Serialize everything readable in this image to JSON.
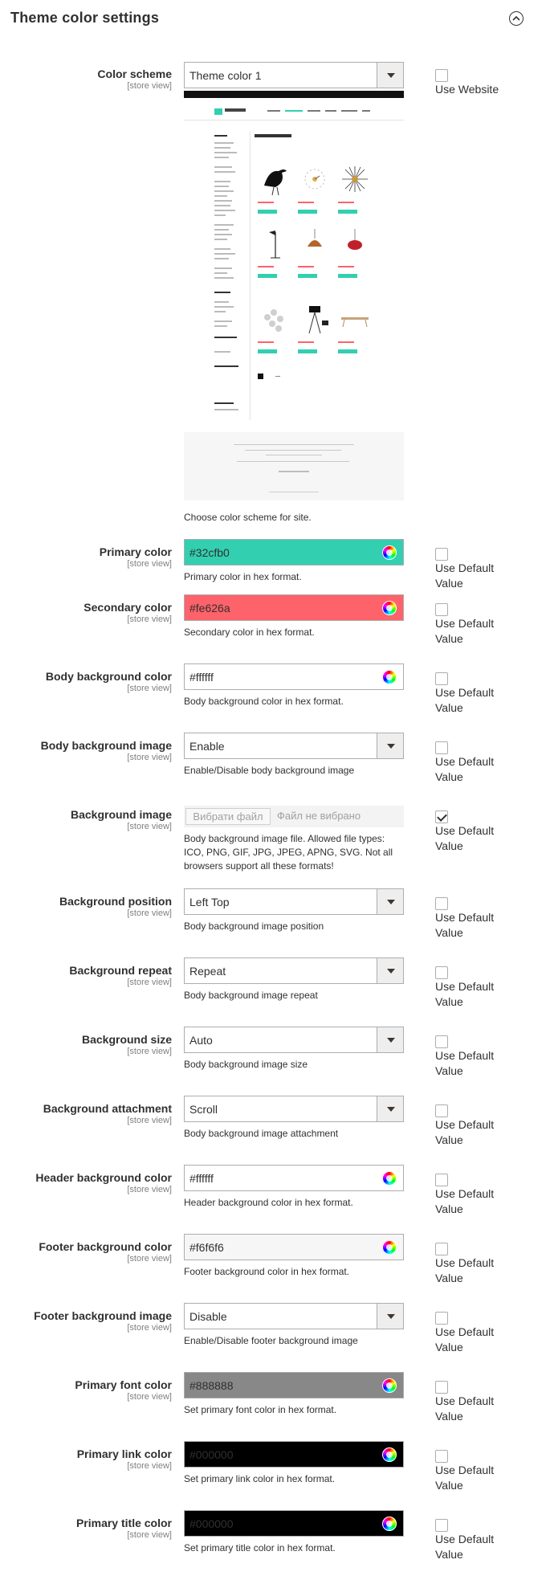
{
  "section": {
    "title": "Theme color settings",
    "collapse_icon": "chevron-up-icon"
  },
  "scope_text": "[store view]",
  "use_default_label": "Use Default Value",
  "color_scheme": {
    "label": "Color scheme",
    "value": "Theme color 1",
    "use_label": "Use Website",
    "note": "Choose color scheme for site.",
    "preview": {
      "page_heading": "Kitchen & Dining",
      "sidebar_extra": "Compare Products",
      "sidebar_wishlist": "My Wish List"
    }
  },
  "fields": [
    {
      "id": "primary",
      "label": "Primary color",
      "type": "color",
      "value": "#32cfb0",
      "bg": "#32cfb0",
      "fg": "#303030",
      "note": "Primary color in hex format.",
      "checked": false
    },
    {
      "id": "secondary",
      "label": "Secondary color",
      "type": "color",
      "value": "#fe626a",
      "bg": "#fe626a",
      "fg": "#303030",
      "note": "Secondary color in hex format.",
      "checked": false
    },
    {
      "id": "body_bg",
      "label": "Body background color",
      "type": "color",
      "value": "#ffffff",
      "bg": "#ffffff",
      "fg": "#303030",
      "note": "Body background color in hex format.",
      "checked": false
    },
    {
      "id": "body_bg_image",
      "label": "Body background image",
      "type": "select",
      "value": "Enable",
      "note": "Enable/Disable body background image",
      "checked": false
    },
    {
      "id": "bg_image",
      "label": "Background image",
      "type": "file",
      "button": "Вибрати файл",
      "value": "Файл не вибрано",
      "note": "Body background image file. Allowed file types: ICO, PNG, GIF, JPG, JPEG, APNG, SVG. Not all browsers support all these formats!",
      "checked": true
    },
    {
      "id": "bg_position",
      "label": "Background position",
      "type": "select",
      "value": "Left Top",
      "note": "Body background image position",
      "checked": false
    },
    {
      "id": "bg_repeat",
      "label": "Background repeat",
      "type": "select",
      "value": "Repeat",
      "note": "Body background image repeat",
      "checked": false
    },
    {
      "id": "bg_size",
      "label": "Background size",
      "type": "select",
      "value": "Auto",
      "note": "Body background image size",
      "checked": false
    },
    {
      "id": "bg_attachment",
      "label": "Background attachment",
      "type": "select",
      "value": "Scroll",
      "note": "Body background image attachment",
      "checked": false
    },
    {
      "id": "header_bg",
      "label": "Header background color",
      "type": "color",
      "value": "#ffffff",
      "bg": "#ffffff",
      "fg": "#303030",
      "note": "Header background color in hex format.",
      "checked": false
    },
    {
      "id": "footer_bg",
      "label": "Footer background color",
      "type": "color",
      "value": "#f6f6f6",
      "bg": "#f6f6f6",
      "fg": "#303030",
      "note": "Footer background color in hex format.",
      "checked": false
    },
    {
      "id": "footer_bg_image",
      "label": "Footer background image",
      "type": "select",
      "value": "Disable",
      "note": "Enable/Disable footer background image",
      "checked": false
    },
    {
      "id": "font_color",
      "label": "Primary font color",
      "type": "color",
      "value": "#888888",
      "bg": "#888888",
      "fg": "#303030",
      "note": "Set primary font color in hex format.",
      "checked": false
    },
    {
      "id": "link_color",
      "label": "Primary link color",
      "type": "color",
      "value": "#000000",
      "bg": "#000000",
      "fg": "#303030",
      "note": "Set primary link color in hex format.",
      "checked": false
    },
    {
      "id": "title_color",
      "label": "Primary title color",
      "type": "color",
      "value": "#000000",
      "bg": "#000000",
      "fg": "#303030",
      "note": "Set primary title color in hex format.",
      "checked": false
    }
  ]
}
